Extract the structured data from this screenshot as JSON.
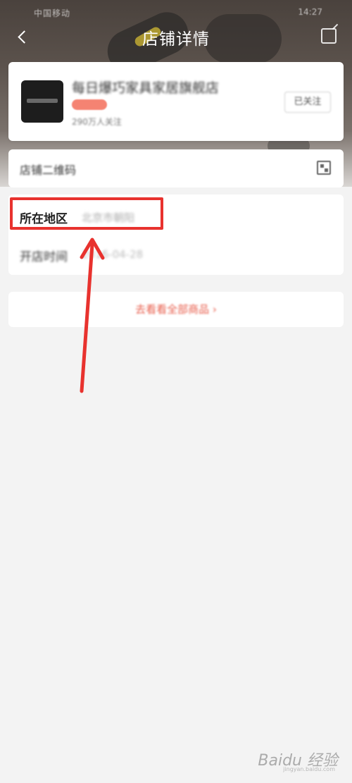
{
  "status_bar": {
    "carrier": "中国移动",
    "time": "14:27"
  },
  "nav": {
    "title": "店铺详情"
  },
  "shop": {
    "name": "每日爆巧家具家居旗舰店",
    "fans": "290万人关注",
    "follow_label": "已关注"
  },
  "qr_row": {
    "label": "店铺二维码"
  },
  "info": {
    "region_label": "所在地区",
    "region_value": "北京市朝阳",
    "open_label": "开店时间",
    "open_value": "2016-04-28"
  },
  "all_products_label": "去看看全部商品 ›",
  "watermark": {
    "brand": "Baidu 经验",
    "sub": "jingyan.baidu.com"
  },
  "colors": {
    "highlight": "#e8322e",
    "accent": "#e85c4a"
  }
}
